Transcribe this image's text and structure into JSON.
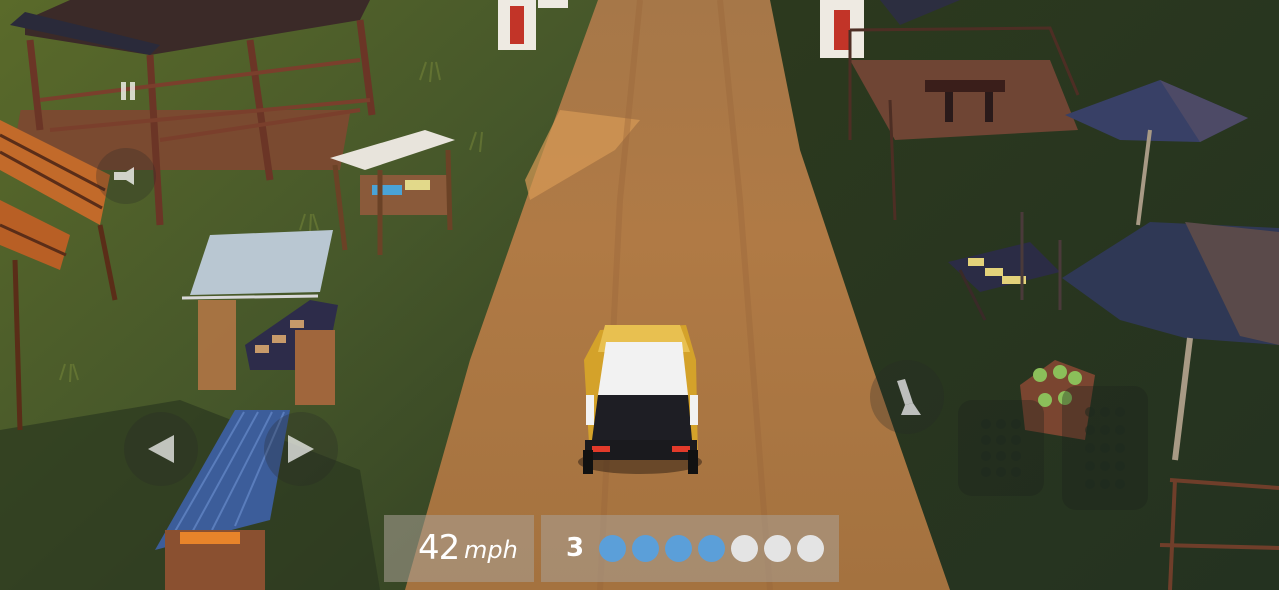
{
  "hud": {
    "speed": {
      "value": "42",
      "unit": "mph"
    },
    "gear": "3",
    "rpm": {
      "total": 7,
      "lit": 4,
      "lit_color": "#5b9fd9",
      "unlit_color": "#e4e4e4"
    }
  },
  "controls": {
    "pause": "pause-icon",
    "camera": "camera-icon",
    "steer_left": "arrow-left-icon",
    "steer_right": "arrow-right-icon",
    "handbrake": "handbrake-icon",
    "brake_pedal": "brake-pedal-icon",
    "gas_pedal": "gas-pedal-icon"
  },
  "colors": {
    "road": "#b07a45",
    "grass": "#3e4d25",
    "car_body": "#d4a22a",
    "car_roof": "#f2f2f2"
  }
}
